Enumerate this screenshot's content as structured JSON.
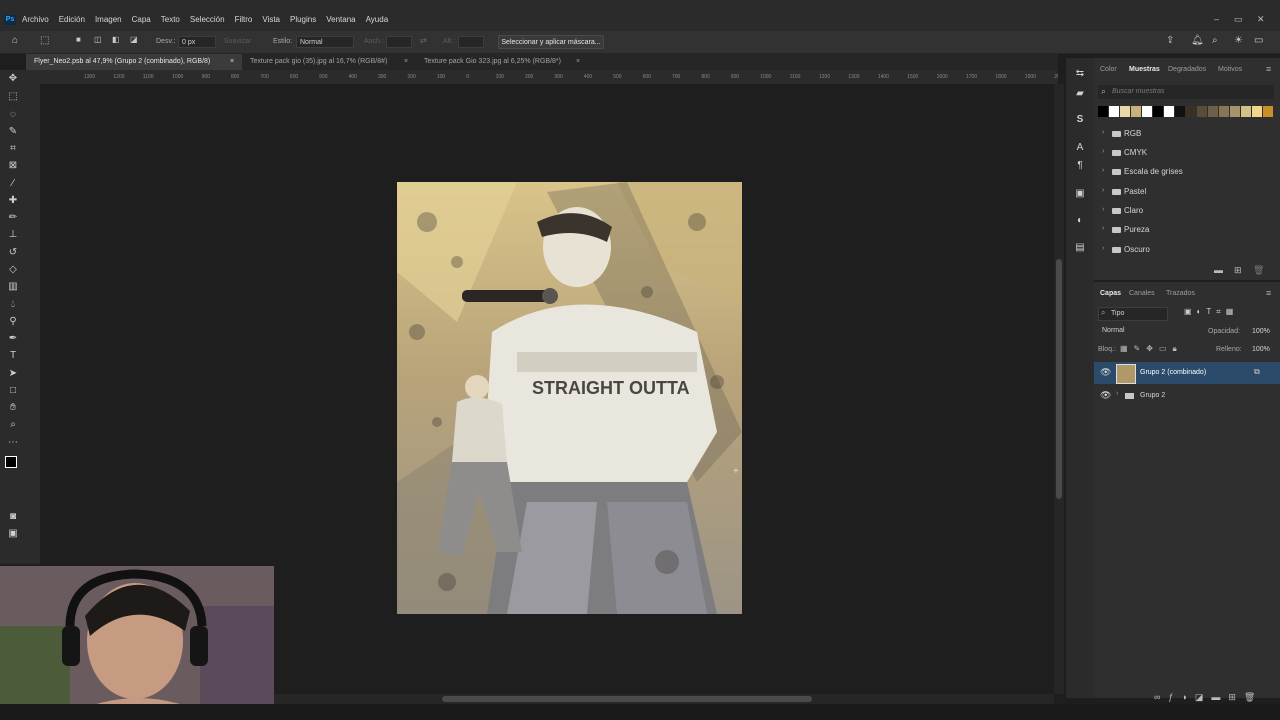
{
  "app": {
    "logo": "Ps"
  },
  "menu": [
    "Archivo",
    "Edición",
    "Imagen",
    "Capa",
    "Texto",
    "Selección",
    "Filtro",
    "Vista",
    "Plugins",
    "Ventana",
    "Ayuda"
  ],
  "window_controls": {
    "minimize": "–",
    "restore": "▭",
    "close": "✕"
  },
  "options": {
    "feather_label": "Desv.:",
    "feather_value": "0 px",
    "antialias_label": "Suavizar",
    "style_label": "Estilo:",
    "style_value": "Normal",
    "width_label": "Anch.:",
    "height_label": "Alt.:",
    "mask_button": "Seleccionar y aplicar máscara..."
  },
  "tabs": [
    {
      "label": "Flyer_Neo2.psb al 47,9% (Grupo 2 (combinado), RGB/8)",
      "close": "×"
    },
    {
      "label": "Texture pack gio (35).jpg al 16,7% (RGB/8#)",
      "close": "×"
    },
    {
      "label": "Texture pack Gio 323.jpg al 6,25% (RGB/8*)",
      "close": "×"
    }
  ],
  "ruler_h": [
    "1300",
    "1200",
    "1100",
    "1000",
    "900",
    "800",
    "700",
    "600",
    "500",
    "400",
    "300",
    "200",
    "100",
    "0",
    "100",
    "200",
    "300",
    "400",
    "500",
    "600",
    "700",
    "800",
    "900",
    "1000",
    "1100",
    "1200",
    "1300",
    "1400",
    "1500",
    "1600",
    "1700",
    "1800",
    "1900",
    "2000"
  ],
  "swatches": {
    "tabs": [
      "Color",
      "Muestras",
      "Degradados",
      "Motivos"
    ],
    "search_placeholder": "Buscar muestras",
    "colors": [
      "#000000",
      "#ffffff",
      "#e8d9a8",
      "#c9b27a",
      "#ffffff",
      "#000000",
      "#ffffff",
      "#111111",
      "#3a3028",
      "#5a4c3a",
      "#6e5f48",
      "#8a7656",
      "#a8946c",
      "#d4c08a",
      "#f0d78a",
      "#c8902a"
    ],
    "folders": [
      "RGB",
      "CMYK",
      "Escala de grises",
      "Pastel",
      "Claro",
      "Pureza",
      "Oscuro"
    ]
  },
  "layers": {
    "tabs": [
      "Capas",
      "Canales",
      "Trazados"
    ],
    "filter_label": "Tipo",
    "blend_mode": "Normal",
    "opacity_label": "Opacidad:",
    "opacity_value": "100%",
    "lock_label": "Bloq.:",
    "fill_label": "Relleno:",
    "fill_value": "100%",
    "items": [
      {
        "name": "Grupo 2 (combinado)",
        "selected": true
      },
      {
        "name": "Grupo 2",
        "selected": false
      }
    ]
  },
  "colors": {
    "accent": "#31a8ff",
    "selection": "#2c4a6a",
    "panel": "#2f2f2f",
    "background": "#1e1e1e"
  }
}
